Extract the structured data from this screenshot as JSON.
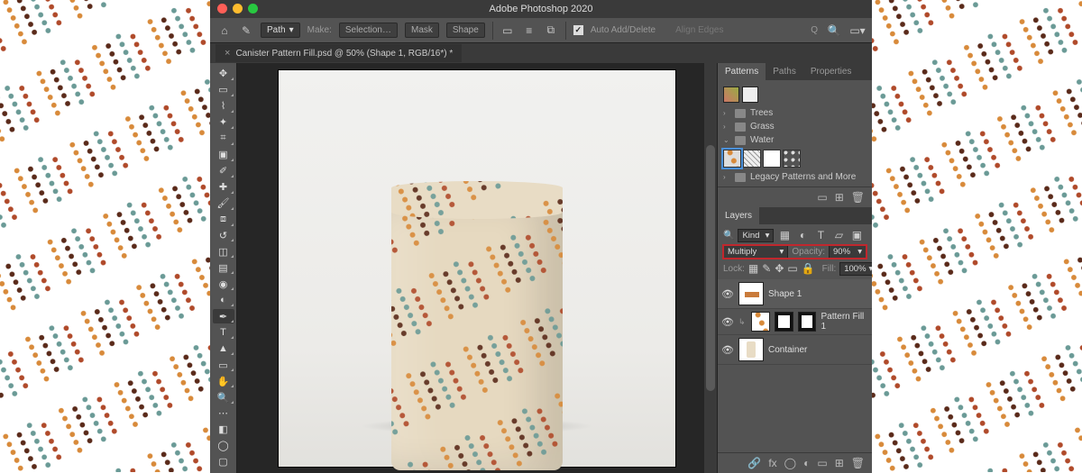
{
  "app_title": "Adobe Photoshop 2020",
  "traffic_colors": {
    "close": "#ff5f57",
    "min": "#febc2e",
    "max": "#28c840"
  },
  "options_bar": {
    "path_label": "Path",
    "make_label": "Make:",
    "selection_btn": "Selection…",
    "mask_btn": "Mask",
    "shape_btn": "Shape",
    "auto_add_delete": "Auto Add/Delete",
    "align_edges": "Align Edges"
  },
  "document_tab": {
    "title": "Canister Pattern Fill.psd @ 50% (Shape 1, RGB/16*) *"
  },
  "tools": [
    "move",
    "marquee",
    "lasso",
    "quick-select",
    "crop",
    "frame",
    "eyedropper",
    "healing-brush",
    "brush",
    "clone-stamp",
    "history-brush",
    "eraser",
    "gradient",
    "blur",
    "dodge",
    "pen",
    "type",
    "path-select",
    "rectangle",
    "hand",
    "zoom",
    "edit-toolbar",
    "foreground-background",
    "quick-mask",
    "screen-mode"
  ],
  "selected_tool_index": 15,
  "panels": {
    "patterns": {
      "tabs": [
        "Patterns",
        "Paths",
        "Properties"
      ],
      "active_tab": 0,
      "folders": [
        "Trees",
        "Grass",
        "Water"
      ],
      "legacy_label": "Legacy Patterns and More"
    },
    "layers": {
      "tab": "Layers",
      "filter_kind": "Kind",
      "blend_mode": "Multiply",
      "opacity_label": "Opacity:",
      "opacity_value": "90%",
      "lock_label": "Lock:",
      "fill_label": "Fill:",
      "fill_value": "100%",
      "items": [
        {
          "name": "Shape 1",
          "visible": true,
          "selected": true,
          "type": "shape"
        },
        {
          "name": "Pattern Fill 1",
          "visible": true,
          "selected": false,
          "type": "fill",
          "masked": true
        },
        {
          "name": "Container",
          "visible": true,
          "selected": false,
          "type": "smart"
        }
      ]
    }
  },
  "q_label": "Q"
}
